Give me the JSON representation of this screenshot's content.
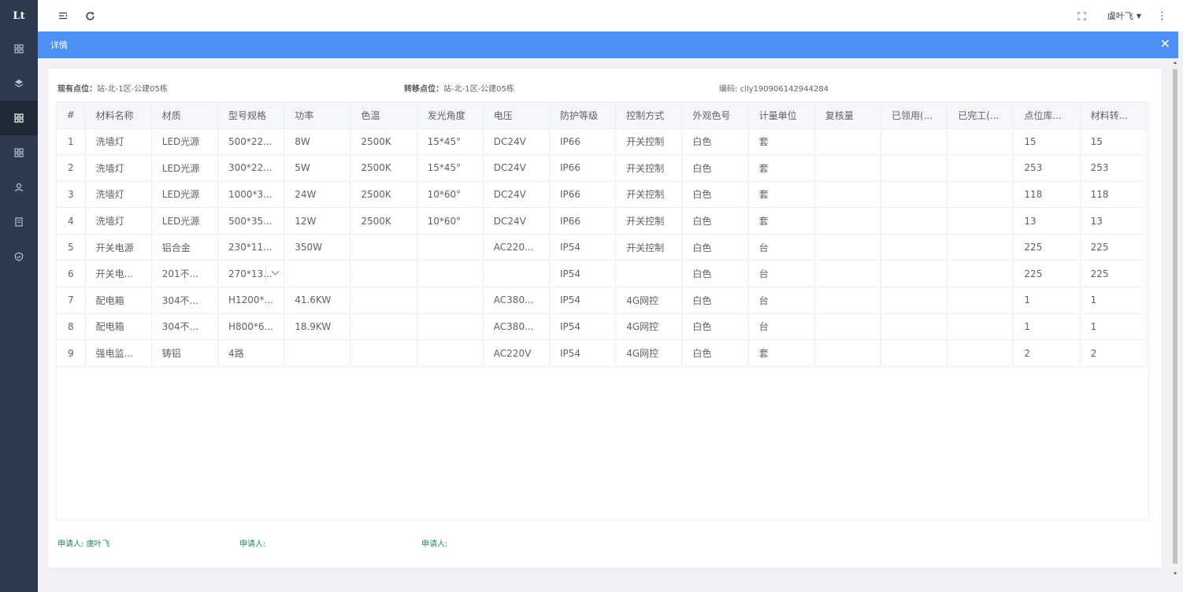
{
  "app": {
    "logo_text": "Lt"
  },
  "topbar": {
    "username": "虞叶飞"
  },
  "dialog": {
    "title": "详情"
  },
  "meta": {
    "current_point_label": "现有点位：",
    "current_point_value": "站-北-1区-公建05栋",
    "transfer_point_label": "转移点位：",
    "transfer_point_value": "站-北-1区-公建05栋",
    "code_label": "编码: ",
    "code_value": "clly190906142944284"
  },
  "table": {
    "columns": [
      "#",
      "材料名称",
      "材质",
      "型号规格",
      "功率",
      "色温",
      "发光角度",
      "电压",
      "防护等级",
      "控制方式",
      "外观色号",
      "计量单位",
      "复核量",
      "已领用(...",
      "已完工(...",
      "点位库...",
      "材料转..."
    ],
    "rows": [
      [
        "1",
        "洗墙灯",
        "LED光源",
        "500*22...",
        "8W",
        "2500K",
        "15*45°",
        "DC24V",
        "IP66",
        "开关控制",
        "白色",
        "套",
        "",
        "",
        "",
        "15",
        "15"
      ],
      [
        "2",
        "洗墙灯",
        "LED光源",
        "300*22...",
        "5W",
        "2500K",
        "15*45°",
        "DC24V",
        "IP66",
        "开关控制",
        "白色",
        "套",
        "",
        "",
        "",
        "253",
        "253"
      ],
      [
        "3",
        "洗墙灯",
        "LED光源",
        "1000*3...",
        "24W",
        "2500K",
        "10*60°",
        "DC24V",
        "IP66",
        "开关控制",
        "白色",
        "套",
        "",
        "",
        "",
        "118",
        "118"
      ],
      [
        "4",
        "洗墙灯",
        "LED光源",
        "500*35...",
        "12W",
        "2500K",
        "10*60°",
        "DC24V",
        "IP66",
        "开关控制",
        "白色",
        "套",
        "",
        "",
        "",
        "13",
        "13"
      ],
      [
        "5",
        "开关电源",
        "铝合金",
        "230*11...",
        "350W",
        "",
        "",
        "AC220...",
        "IP54",
        "开关控制",
        "白色",
        "台",
        "",
        "",
        "",
        "225",
        "225"
      ],
      [
        "6",
        "开关电...",
        "201不...",
        "270*13...",
        "",
        "",
        "",
        "",
        "IP54",
        "",
        "白色",
        "台",
        "",
        "",
        "",
        "225",
        "225"
      ],
      [
        "7",
        "配电箱",
        "304不...",
        "H1200*...",
        "41.6KW",
        "",
        "",
        "AC380...",
        "IP54",
        "4G网控",
        "白色",
        "台",
        "",
        "",
        "",
        "1",
        "1"
      ],
      [
        "8",
        "配电箱",
        "304不...",
        "H800*6...",
        "18.9KW",
        "",
        "",
        "AC380...",
        "IP54",
        "4G网控",
        "白色",
        "台",
        "",
        "",
        "",
        "1",
        "1"
      ],
      [
        "9",
        "强电监...",
        "铸铝",
        "4路",
        "",
        "",
        "",
        "AC220V",
        "IP54",
        "4G网控",
        "白色",
        "套",
        "",
        "",
        "",
        "2",
        "2"
      ]
    ]
  },
  "footer": {
    "applicant1": "申请人: 虞叶飞",
    "applicant2": "申请人:",
    "applicant3": "申请人:"
  }
}
